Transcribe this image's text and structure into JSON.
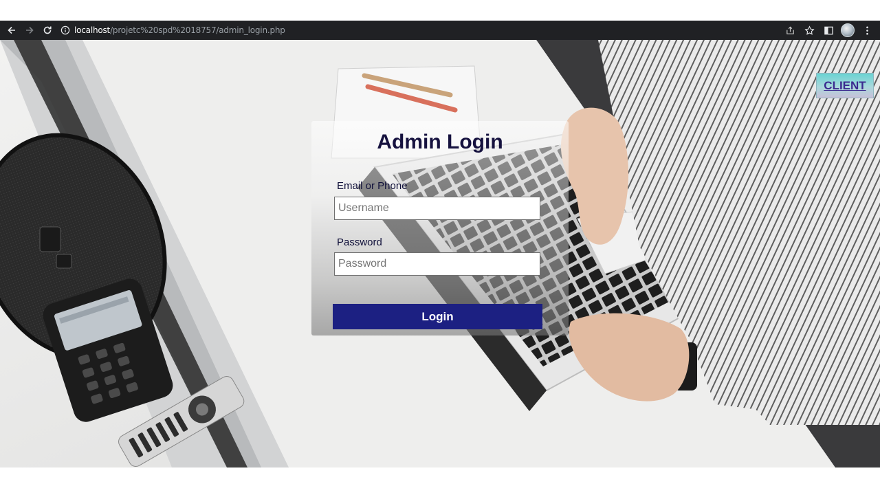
{
  "browser": {
    "url_host": "localhost",
    "url_path": "/projetc%20spd%2018757/admin_login.php"
  },
  "page": {
    "client_link_label": "CLIENT",
    "title": "Admin Login",
    "email_label": "Email or Phone",
    "email_placeholder": "Username",
    "password_label": "Password",
    "password_placeholder": "Password",
    "login_button_label": "Login"
  },
  "colors": {
    "chrome_bg": "#202124",
    "login_button": "#1c2082",
    "title_text": "#16123f",
    "client_link_text": "#3b2a8f"
  }
}
